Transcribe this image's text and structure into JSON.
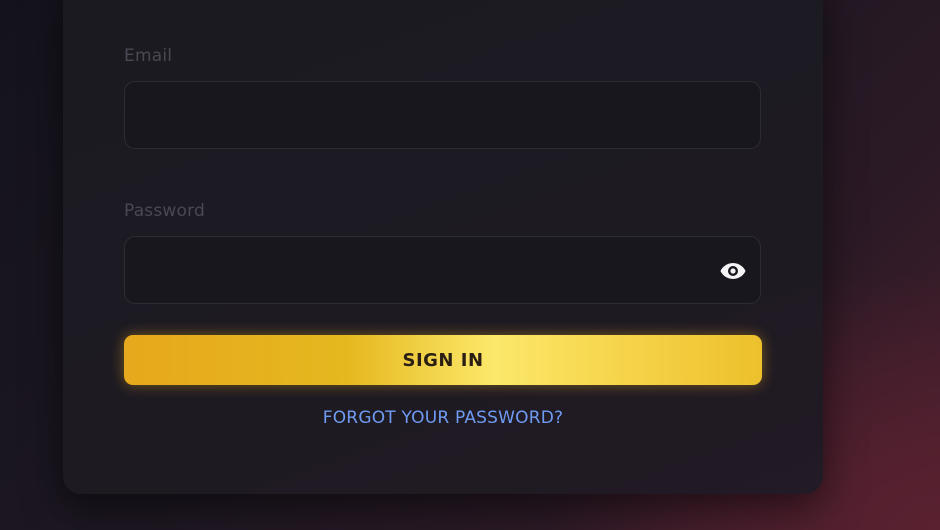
{
  "form": {
    "email_label": "Email",
    "email_value": "",
    "password_label": "Password",
    "password_value": "",
    "show_password_icon": "eye-icon",
    "submit_label": "SIGN IN",
    "forgot_link": "FORGOT YOUR PASSWORD?"
  },
  "colors": {
    "accent": "#f2c94c",
    "link": "#6f9bf2",
    "card_background": "#1b1a21"
  }
}
